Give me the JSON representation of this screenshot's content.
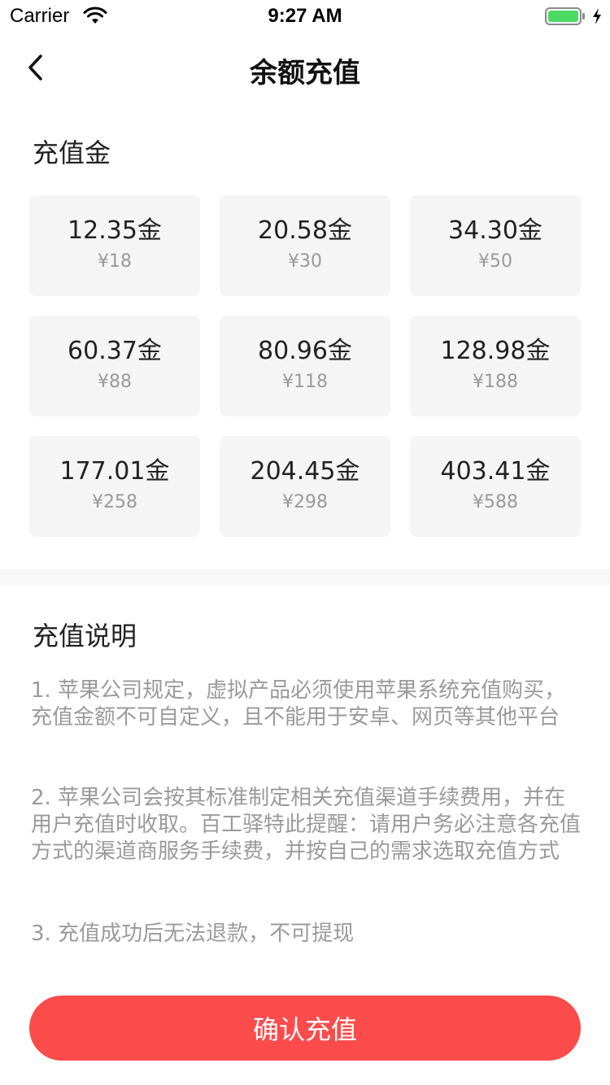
{
  "status_bar": {
    "carrier": "Carrier",
    "time": "9:27 AM",
    "battery_color": "#4cd964"
  },
  "nav": {
    "title": "余额充值",
    "back_icon": "chevron-left-icon"
  },
  "recharge": {
    "heading": "充值金",
    "options": [
      {
        "gold": "12.35金",
        "price": "¥18"
      },
      {
        "gold": "20.58金",
        "price": "¥30"
      },
      {
        "gold": "34.30金",
        "price": "¥50"
      },
      {
        "gold": "60.37金",
        "price": "¥88"
      },
      {
        "gold": "80.96金",
        "price": "¥118"
      },
      {
        "gold": "128.98金",
        "price": "¥188"
      },
      {
        "gold": "177.01金",
        "price": "¥258"
      },
      {
        "gold": "204.45金",
        "price": "¥298"
      },
      {
        "gold": "403.41金",
        "price": "¥588"
      }
    ]
  },
  "notes": {
    "heading": "充值说明",
    "items": [
      "1. 苹果公司规定，虚拟产品必须使用苹果系统充值购买，充值金额不可自定义，且不能用于安卓、网页等其他平台",
      "2. 苹果公司会按其标准制定相关充值渠道手续费用，并在用户充值时收取。百工驿特此提醒：请用户务必注意各充值方式的渠道商服务手续费，并按自己的需求选取充值方式",
      "3. 充值成功后无法退款，不可提现"
    ]
  },
  "confirm": {
    "label": "确认充值",
    "color": "#fc4b4b"
  }
}
